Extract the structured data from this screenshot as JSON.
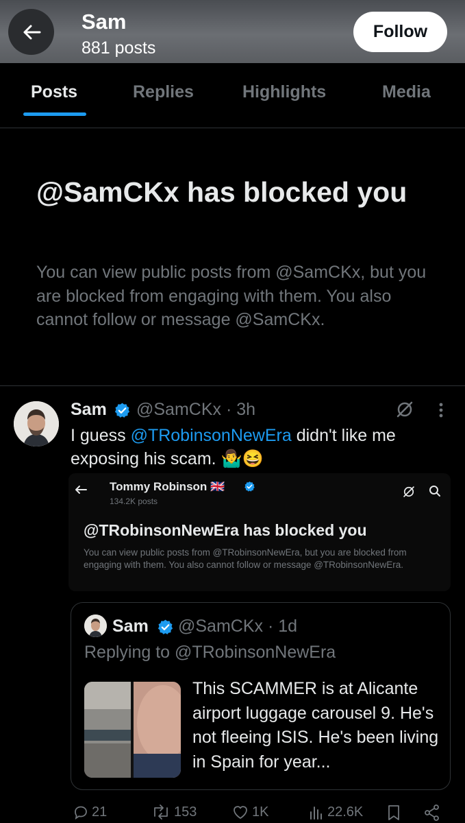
{
  "header": {
    "name": "Sam",
    "post_count": "881 posts",
    "follow_label": "Follow"
  },
  "tabs": [
    {
      "label": "Posts",
      "active": true
    },
    {
      "label": "Replies",
      "active": false
    },
    {
      "label": "Highlights",
      "active": false
    },
    {
      "label": "Media",
      "active": false
    }
  ],
  "blocked_notice": {
    "title": "@SamCKx has blocked you",
    "description": "You can view public posts from @SamCKx, but you are blocked from engaging with them. You also cannot follow or message @SamCKx."
  },
  "post": {
    "author_name": "Sam",
    "handle_time": "@SamCKx · 3h",
    "text_before": "I guess ",
    "mention": "@TRobinsonNewEra",
    "text_after": " didn't like me exposing his scam. 🤷‍♂️😆",
    "embedded_screenshot": {
      "name": "Tommy Robinson 🇬🇧",
      "post_count": "134.2K posts",
      "title": "@TRobinsonNewEra has blocked you",
      "description": "You can view public posts from @TRobinsonNewEra, but you are blocked from engaging with them. You also cannot follow or message @TRobinsonNewEra."
    },
    "quote": {
      "author_name": "Sam",
      "handle_time": "@SamCKx · 1d",
      "replying_to": "Replying to @TRobinsonNewEra",
      "text": "This SCAMMER is at Alicante airport luggage carousel 9. He's not fleeing ISIS. He's been living in Spain for year..."
    },
    "actions": {
      "replies": "21",
      "reposts": "153",
      "likes": "1K",
      "views": "22.6K"
    }
  },
  "icons": {
    "back": "arrow-left-icon",
    "verified": "verified-badge-icon",
    "grok": "grok-icon",
    "more": "more-vertical-icon",
    "reply": "reply-icon",
    "repost": "repost-icon",
    "like": "heart-icon",
    "views": "views-icon",
    "bookmark": "bookmark-icon",
    "share": "share-icon"
  },
  "colors": {
    "accent": "#1d9bf0",
    "background": "#000000",
    "secondary_text": "#71767b"
  }
}
